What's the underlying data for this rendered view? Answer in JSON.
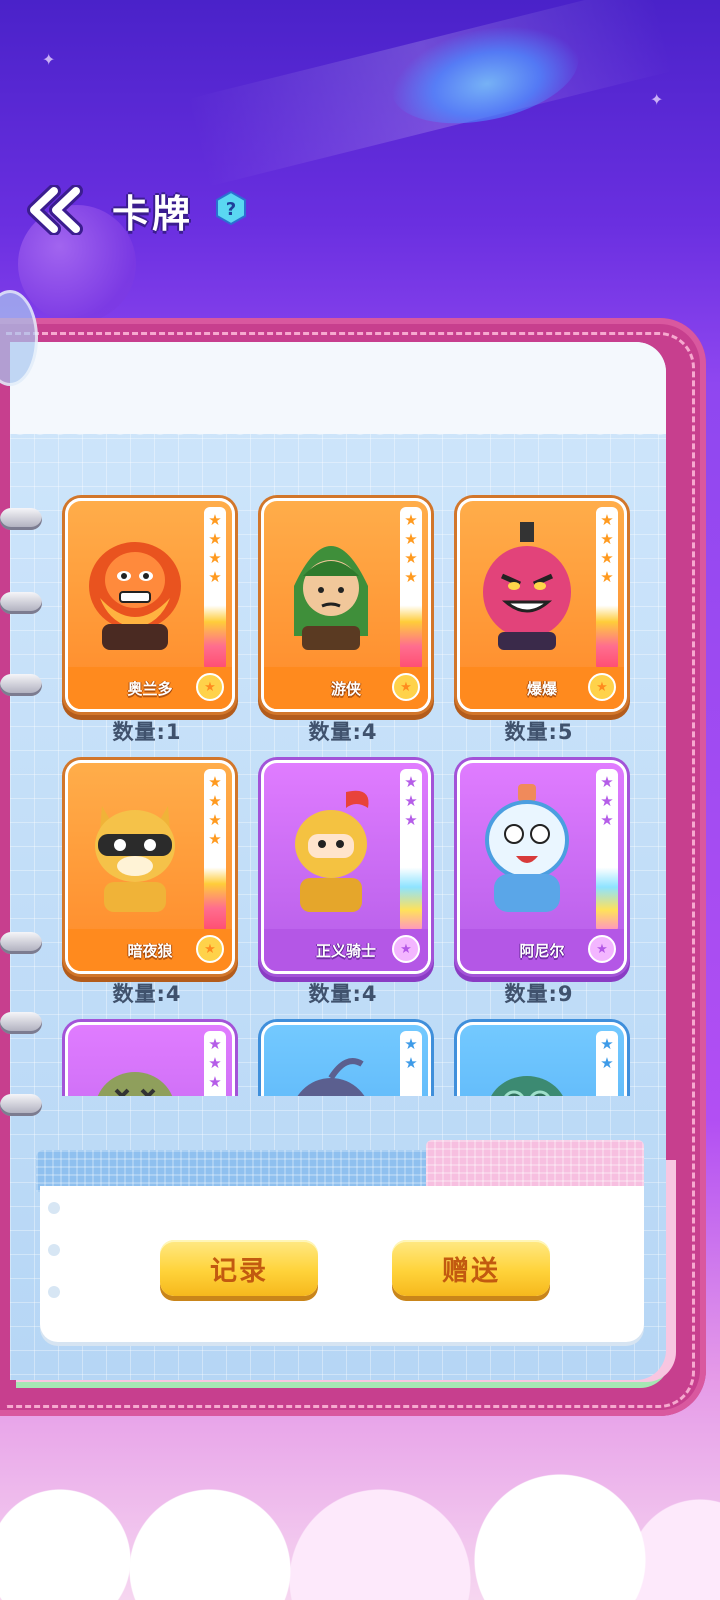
{
  "header": {
    "title": "卡牌",
    "help_label": "?"
  },
  "cards": [
    {
      "name": "奥兰多",
      "quantity": "数量:1",
      "rarity": "orange",
      "stars": 4
    },
    {
      "name": "游侠",
      "quantity": "数量:4",
      "rarity": "orange",
      "stars": 4
    },
    {
      "name": "爆爆",
      "quantity": "数量:5",
      "rarity": "orange",
      "stars": 4
    },
    {
      "name": "暗夜狼",
      "quantity": "数量:4",
      "rarity": "orange",
      "stars": 4
    },
    {
      "name": "正义骑士",
      "quantity": "数量:4",
      "rarity": "purple",
      "stars": 3
    },
    {
      "name": "阿尼尔",
      "quantity": "数量:9",
      "rarity": "purple",
      "stars": 3
    },
    {
      "name": "",
      "quantity": "",
      "rarity": "purple",
      "stars": 3
    },
    {
      "name": "",
      "quantity": "",
      "rarity": "blue",
      "stars": 2
    },
    {
      "name": "",
      "quantity": "",
      "rarity": "blue",
      "stars": 2
    }
  ],
  "actions": {
    "record_label": "记录",
    "gift_label": "赠送"
  },
  "colors": {
    "orange_card": "#ff9a2e",
    "purple_card": "#c46cf0",
    "blue_card": "#5ab6f8",
    "button_yellow": "#ffd33a",
    "button_text": "#c25a10",
    "notebook_pink": "#c73f8e"
  }
}
